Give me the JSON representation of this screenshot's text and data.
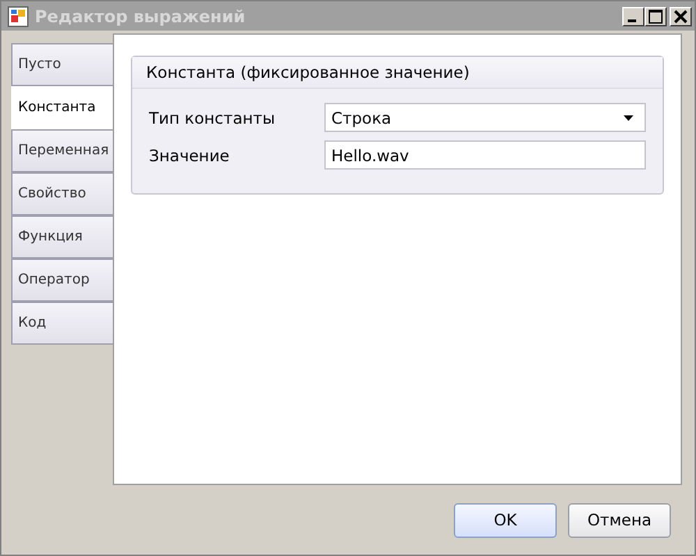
{
  "window": {
    "title": "Редактор выражений"
  },
  "tabs": [
    {
      "label": "Пусто",
      "selected": false
    },
    {
      "label": "Константа",
      "selected": true
    },
    {
      "label": "Переменная",
      "selected": false
    },
    {
      "label": "Свойство",
      "selected": false
    },
    {
      "label": "Функция",
      "selected": false
    },
    {
      "label": "Оператор",
      "selected": false
    },
    {
      "label": "Код",
      "selected": false
    }
  ],
  "group": {
    "title": "Константа (фиксированное значение)",
    "fields": [
      {
        "kind": "dropdown",
        "label": "Тип константы",
        "value": "Строка"
      },
      {
        "kind": "text",
        "label": "Значение",
        "value": "Hello.wav"
      }
    ]
  },
  "buttons": [
    {
      "label": "OK",
      "default": true
    },
    {
      "label": "Отмена",
      "default": false
    }
  ]
}
